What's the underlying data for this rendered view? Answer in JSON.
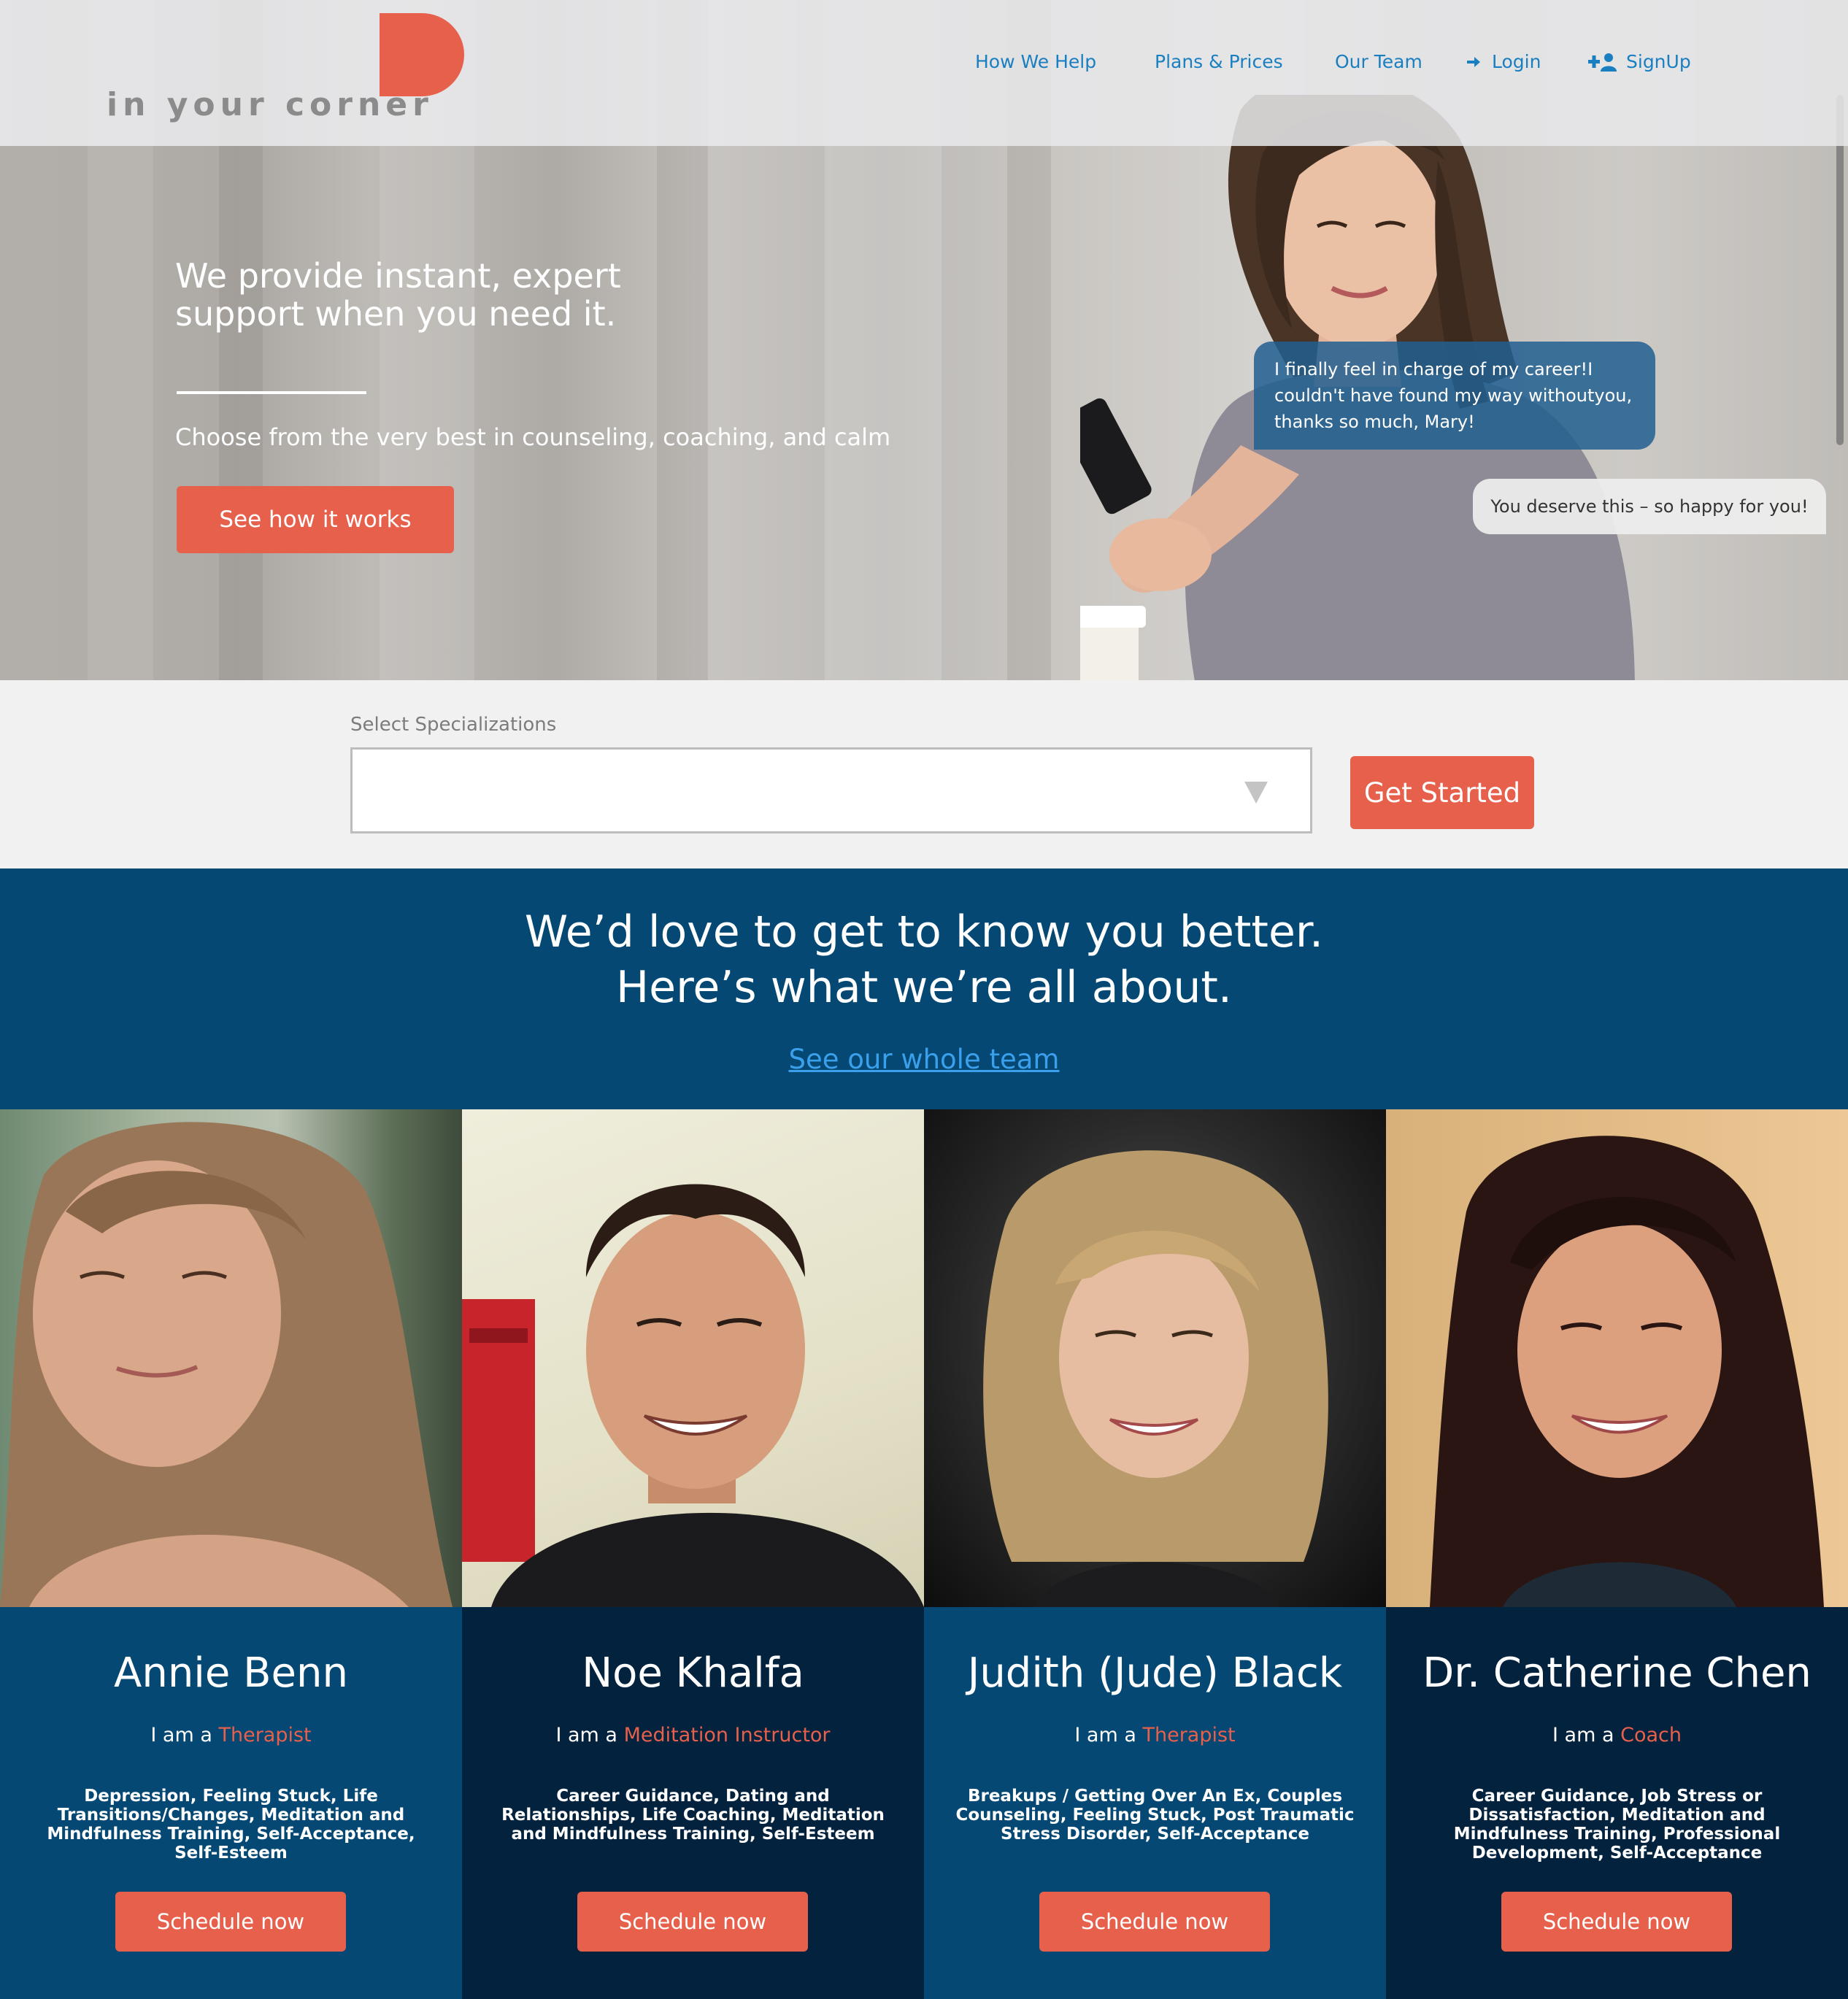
{
  "brand": {
    "logo_text": "in your corner",
    "accent_color": "#e7604c",
    "navy": "#044873"
  },
  "nav": {
    "items": [
      {
        "label": "How We Help"
      },
      {
        "label": "Plans & Prices"
      },
      {
        "label": "Our Team"
      },
      {
        "label": "Login",
        "icon": "login-icon"
      },
      {
        "label": "SignUp",
        "icon": "add-user-icon"
      }
    ]
  },
  "hero": {
    "title": "We provide instant, expert support when you need it.",
    "subtitle": "Choose from the very best in counseling, coaching, and calm",
    "cta": "See how it works",
    "chat_client": "I finally feel in charge of my career!I couldn't have found my way withoutyou, thanks so much, Mary!",
    "chat_coach": "You deserve this – so happy for you!"
  },
  "search": {
    "label": "Select Specializations",
    "value": "",
    "button": "Get Started"
  },
  "about": {
    "line1": "We’d love to get to know you better.",
    "line2": "Here’s what we’re all about.",
    "link": "See our whole team"
  },
  "team": [
    {
      "name": "Annie Benn",
      "prefix": "I am a",
      "role": "Therapist",
      "specialties": "Depression, Feeling Stuck, Life Transitions/Changes, Meditation and Mindfulness Training, Self-Acceptance, Self-Esteem",
      "button": "Schedule now"
    },
    {
      "name": "Noe Khalfa",
      "prefix": "I am a",
      "role": "Meditation Instructor",
      "specialties": "Career Guidance, Dating and Relationships, Life Coaching, Meditation and Mindfulness Training, Self-Esteem",
      "button": "Schedule now"
    },
    {
      "name": "Judith (Jude) Black",
      "prefix": "I am a",
      "role": "Therapist",
      "specialties": "Breakups / Getting Over An Ex, Couples Counseling, Feeling Stuck, Post Traumatic Stress Disorder, Self-Acceptance",
      "button": "Schedule now"
    },
    {
      "name": "Dr. Catherine Chen",
      "prefix": "I am a",
      "role": "Coach",
      "specialties": "Career Guidance, Job Stress or Dissatisfaction, Meditation and Mindfulness Training, Professional Development, Self-Acceptance",
      "button": "Schedule now"
    }
  ]
}
